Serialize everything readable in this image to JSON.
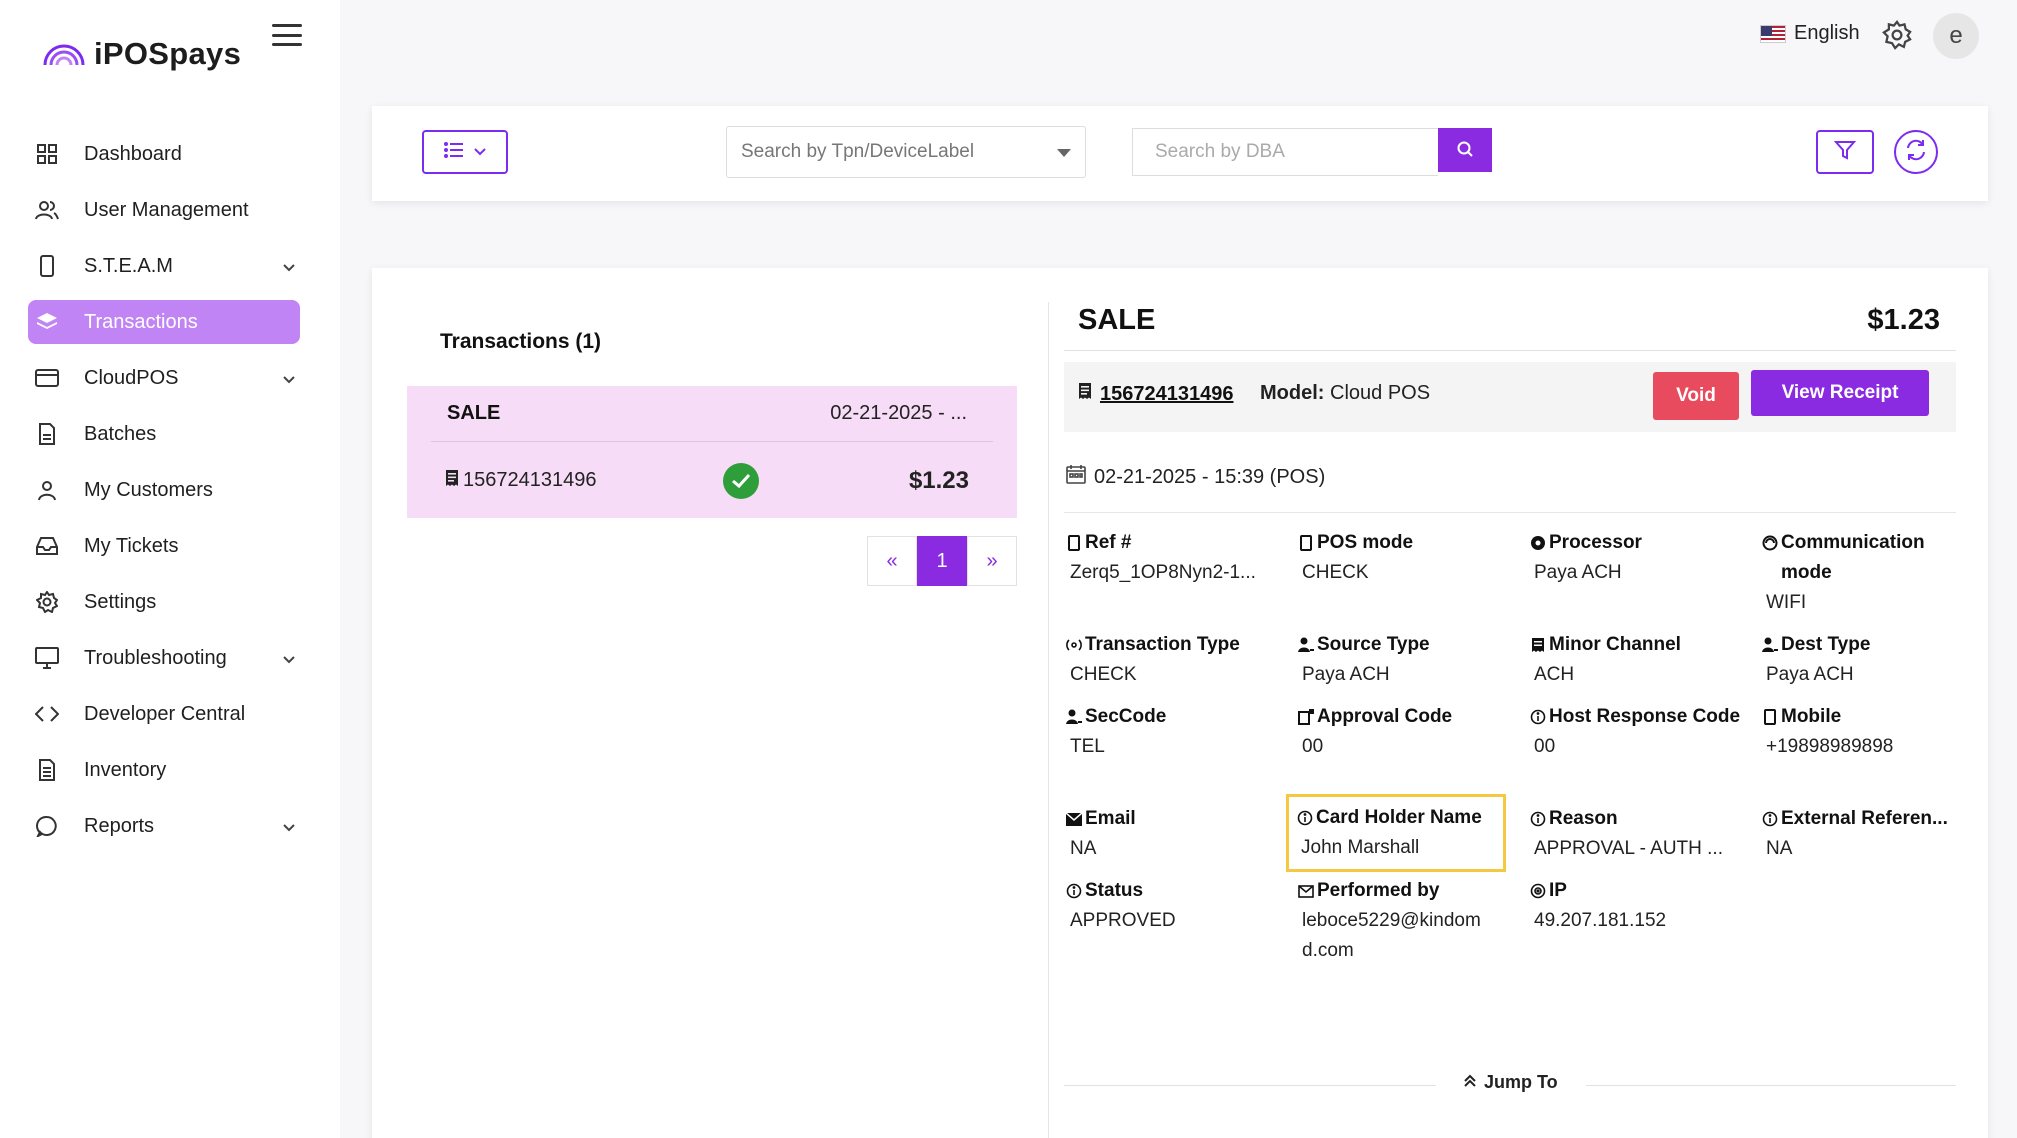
{
  "app": {
    "brand": "iPOSpays",
    "language": "English",
    "avatar_initial": "e",
    "accent_color": "#8a2be2",
    "active_nav_color": "#c084f5"
  },
  "sidebar": {
    "items": [
      {
        "label": "Dashboard",
        "icon": "grid-icon",
        "expandable": false
      },
      {
        "label": "User Management",
        "icon": "users-icon",
        "expandable": true
      },
      {
        "label": "S.T.E.A.M",
        "icon": "device-icon",
        "expandable": true
      },
      {
        "label": "Transactions",
        "icon": "layers-icon",
        "expandable": false,
        "active": true
      },
      {
        "label": "CloudPOS",
        "icon": "card-icon",
        "expandable": true
      },
      {
        "label": "Batches",
        "icon": "file-icon",
        "expandable": false
      },
      {
        "label": "My Customers",
        "icon": "user-icon",
        "expandable": false
      },
      {
        "label": "My Tickets",
        "icon": "inbox-icon",
        "expandable": false
      },
      {
        "label": "Settings",
        "icon": "gear-icon",
        "expandable": false
      },
      {
        "label": "Troubleshooting",
        "icon": "monitor-icon",
        "expandable": true
      },
      {
        "label": "Developer Central",
        "icon": "code-icon",
        "expandable": false
      },
      {
        "label": "Inventory",
        "icon": "document-icon",
        "expandable": false
      },
      {
        "label": "Reports",
        "icon": "chat-icon",
        "expandable": true
      }
    ]
  },
  "toolbar": {
    "tpn_placeholder": "Search by Tpn/DeviceLabel",
    "dba_placeholder": "Search by DBA"
  },
  "transactions": {
    "heading": "Transactions (1)",
    "items": [
      {
        "type": "SALE",
        "date": "02-21-2025 - ...",
        "id": "156724131496",
        "amount": "$1.23",
        "status": "approved"
      }
    ],
    "pager": {
      "prev": "«",
      "current": "1",
      "next": "»"
    }
  },
  "detail": {
    "title": "SALE",
    "amount": "$1.23",
    "id": "156724131496",
    "model_label": "Model:",
    "model_value": "Cloud POS",
    "void_label": "Void",
    "receipt_label": "View Receipt",
    "datetime": "02-21-2025 - 15:39 (POS)",
    "fields": [
      {
        "label": "Ref #",
        "value": "Zerq5_1OP8Nyn2-1...",
        "icon": "device-icon"
      },
      {
        "label": "POS mode",
        "value": "CHECK",
        "icon": "device-icon"
      },
      {
        "label": "Processor",
        "value": "Paya ACH",
        "icon": "settings-icon"
      },
      {
        "label": "Communication mode",
        "value": "WIFI",
        "icon": "wifi-icon"
      },
      {
        "label": "Transaction Type",
        "value": "CHECK",
        "icon": "broadcast-icon"
      },
      {
        "label": "Source Type",
        "value": "Paya ACH",
        "icon": "person-icon"
      },
      {
        "label": "Minor Channel",
        "value": "ACH",
        "icon": "receipt-icon"
      },
      {
        "label": "Dest Type",
        "value": "Paya ACH",
        "icon": "person-icon"
      },
      {
        "label": "SecCode",
        "value": "TEL",
        "icon": "person-icon"
      },
      {
        "label": "Approval Code",
        "value": "00",
        "icon": "approval-icon"
      },
      {
        "label": "Host Response Code",
        "value": "00",
        "icon": "info-icon"
      },
      {
        "label": "Mobile",
        "value": "+19898989898",
        "icon": "mobile-icon"
      },
      {
        "label": "Email",
        "value": "NA",
        "icon": "email-icon"
      },
      {
        "label": "Card Holder Name",
        "value": "John Marshall",
        "icon": "info-icon",
        "highlight": true
      },
      {
        "label": "Reason",
        "value": "APPROVAL - AUTH ...",
        "icon": "info-icon"
      },
      {
        "label": "External Referen...",
        "value": "NA",
        "icon": "info-icon"
      },
      {
        "label": "Status",
        "value": "APPROVED",
        "icon": "info-icon"
      },
      {
        "label": "Performed by",
        "value": "leboce5229@kindom d.com",
        "icon": "email-icon"
      },
      {
        "label": "IP",
        "value": "49.207.181.152",
        "icon": "location-icon"
      }
    ],
    "jump_label": "Jump To"
  }
}
